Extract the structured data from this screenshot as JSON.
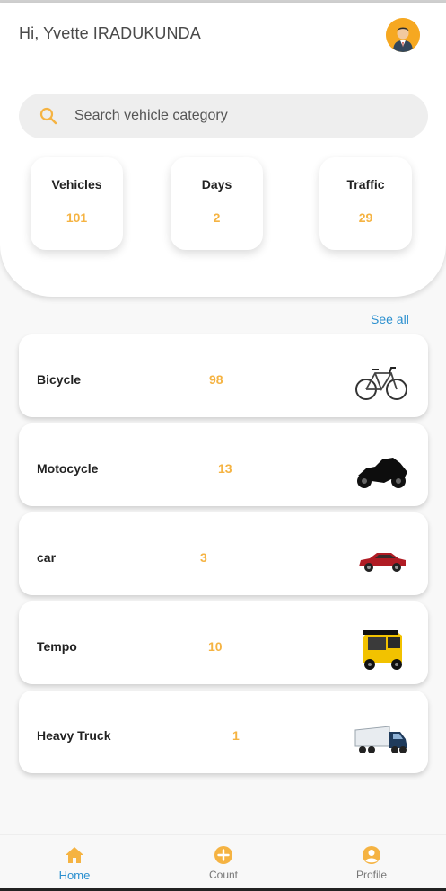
{
  "header": {
    "greeting": "Hi, Yvette IRADUKUNDA",
    "avatar_icon": "user-avatar-icon"
  },
  "search": {
    "placeholder": "Search vehicle category",
    "icon": "search-icon"
  },
  "stats": [
    {
      "label": "Vehicles",
      "value": "101"
    },
    {
      "label": "Days",
      "value": "2"
    },
    {
      "label": "Traffic",
      "value": "29"
    }
  ],
  "see_all_label": "See all",
  "categories": [
    {
      "name": "Bicycle",
      "count": "98",
      "icon": "bicycle-icon"
    },
    {
      "name": "Motocycle",
      "count": "13",
      "icon": "motorcycle-icon"
    },
    {
      "name": "car",
      "count": "3",
      "icon": "car-icon"
    },
    {
      "name": "Tempo",
      "count": "10",
      "icon": "tempo-icon"
    },
    {
      "name": "Heavy Truck",
      "count": "1",
      "icon": "truck-icon"
    }
  ],
  "nav": [
    {
      "label": "Home",
      "icon": "home-icon",
      "active": true
    },
    {
      "label": "Count",
      "icon": "add-circle-icon",
      "active": false
    },
    {
      "label": "Profile",
      "icon": "profile-icon",
      "active": false
    }
  ],
  "colors": {
    "accent": "#f5b342",
    "link": "#2a8fcf",
    "avatar_bg": "#f6a821"
  }
}
